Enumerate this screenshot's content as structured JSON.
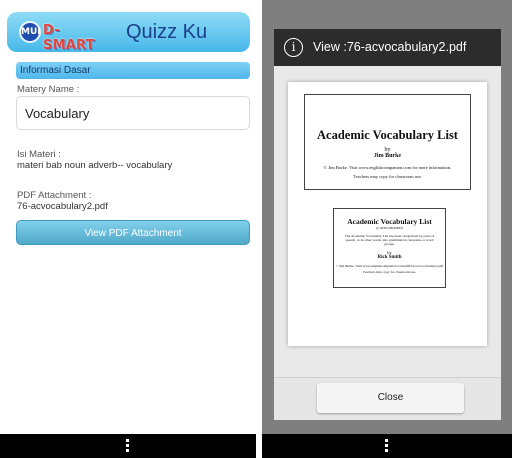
{
  "left_screen": {
    "logo": {
      "mark": "MUI",
      "text": "D-SMART"
    },
    "app_title": "Quizz Ku",
    "section_title": "Informasi Dasar",
    "matery_label": "Matery Name :",
    "matery_value": "Vocabulary",
    "isi_label": "Isi Materi :",
    "isi_value": "materi bab noun adverb-- vocabulary",
    "pdf_label": "PDF Attachment :",
    "pdf_value": "76-acvocabulary2.pdf",
    "view_button": "View PDF Attachment",
    "accent_color": "#4fb6ea"
  },
  "right_screen": {
    "dialog_title": "View :76-acvocabulary2.pdf",
    "info_icon": "i",
    "pdf_preview": {
      "doc1": {
        "title": "Academic Vocabulary List",
        "by": "by",
        "author": "Jim Burke",
        "note": "© Jim Burke. Visit www.englishcompanion.com for more information.",
        "note2": "Teachers may copy for classroom use."
      },
      "doc2": {
        "title": "Academic Vocabulary List",
        "subtitle": "(CATEGORIZED)",
        "text": "The Academic Vocabulary List has been categorized by parts of speech, or in other words, into grammatical categories or word groups.",
        "by": "by",
        "author": "Rick Smith",
        "note": "© Jim Burke. Visit www.englishcompanion.com/pdfDocs/acvocabulary2.pdf",
        "note2": "Teachers may copy for classroom use."
      }
    },
    "close_button": "Close"
  },
  "navbar": {
    "menu_icon": "overflow-menu-icon"
  }
}
